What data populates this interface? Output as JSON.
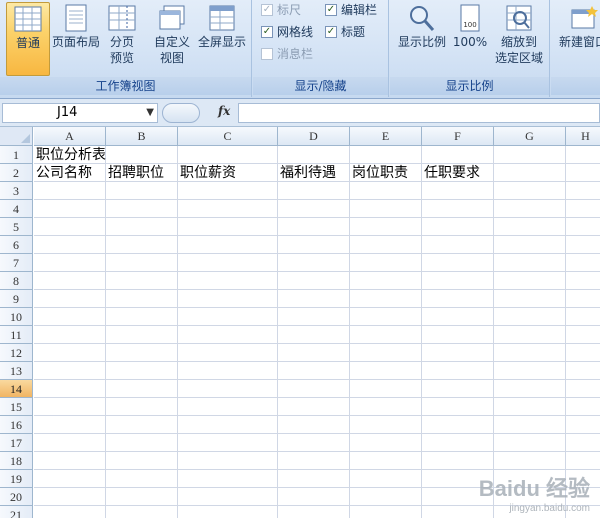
{
  "ribbon": {
    "workbook_views": {
      "label": "工作簿视图",
      "normal": "普通",
      "page_layout": "页面布局",
      "page_break_line1": "分页",
      "page_break_line2": "预览",
      "custom_line1": "自定义",
      "custom_line2": "视图",
      "full_screen": "全屏显示"
    },
    "show_hide": {
      "label": "显示/隐藏",
      "ruler": "标尺",
      "gridlines": "网格线",
      "message_bar": "消息栏",
      "formula_bar": "编辑栏",
      "headings": "标题"
    },
    "zoom": {
      "label": "显示比例",
      "zoom": "显示比例",
      "hundred": "100%",
      "zoom_sel_line1": "缩放到",
      "zoom_sel_line2": "选定区域"
    },
    "window": {
      "new_window": "新建窗口"
    }
  },
  "formula_bar": {
    "name_box": "J14",
    "fx": "fx",
    "formula": ""
  },
  "grid": {
    "columns": [
      "A",
      "B",
      "C",
      "D",
      "E",
      "F",
      "G",
      "H"
    ],
    "rows": [
      "1",
      "2",
      "3",
      "4",
      "5",
      "6",
      "7",
      "8",
      "9",
      "10",
      "11",
      "12",
      "13",
      "14",
      "15",
      "16",
      "17",
      "18",
      "19",
      "20",
      "21"
    ],
    "selected_row": "14",
    "cells": {
      "A1": "职位分析表",
      "A2": "公司名称",
      "B2": "招聘职位",
      "C2": "职位薪资",
      "D2": "福利待遇",
      "E2": "岗位职责",
      "F2": "任职要求"
    }
  },
  "watermark": {
    "logo": "Baidu 经验",
    "url": "jingyan.baidu.com"
  }
}
